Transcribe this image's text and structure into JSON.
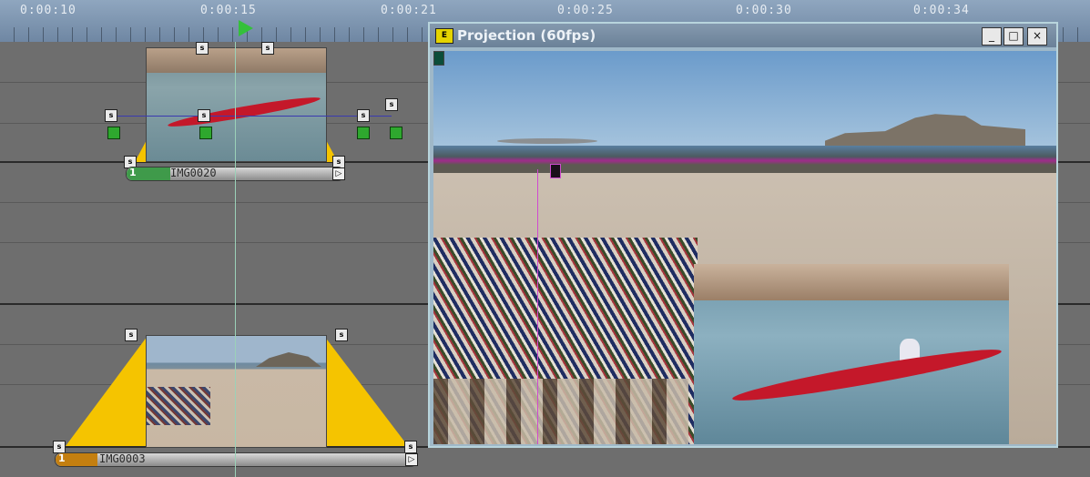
{
  "ruler": {
    "labels": [
      "0:00:10",
      "0:00:15",
      "0:00:21",
      "0:00:25",
      "0:00:30",
      "0:00:34"
    ]
  },
  "tracks": [
    {
      "clip_name": "IMG0020",
      "clip_number": "1",
      "bar_color": "#3f9a4a"
    },
    {
      "clip_name": "IMG0003",
      "clip_number": "1",
      "bar_color": "#c47f10"
    }
  ],
  "window": {
    "title": "Projection (60fps)",
    "app_icon": "E",
    "buttons": {
      "minimize": "_",
      "maximize": "□",
      "close": "×"
    }
  },
  "handles": {
    "glyph": "s",
    "end_glyph": "▷"
  },
  "colors": {
    "accent_yellow": "#f5c400",
    "playhead_green": "#34c03a",
    "guide_magenta": "#d04ad0"
  }
}
